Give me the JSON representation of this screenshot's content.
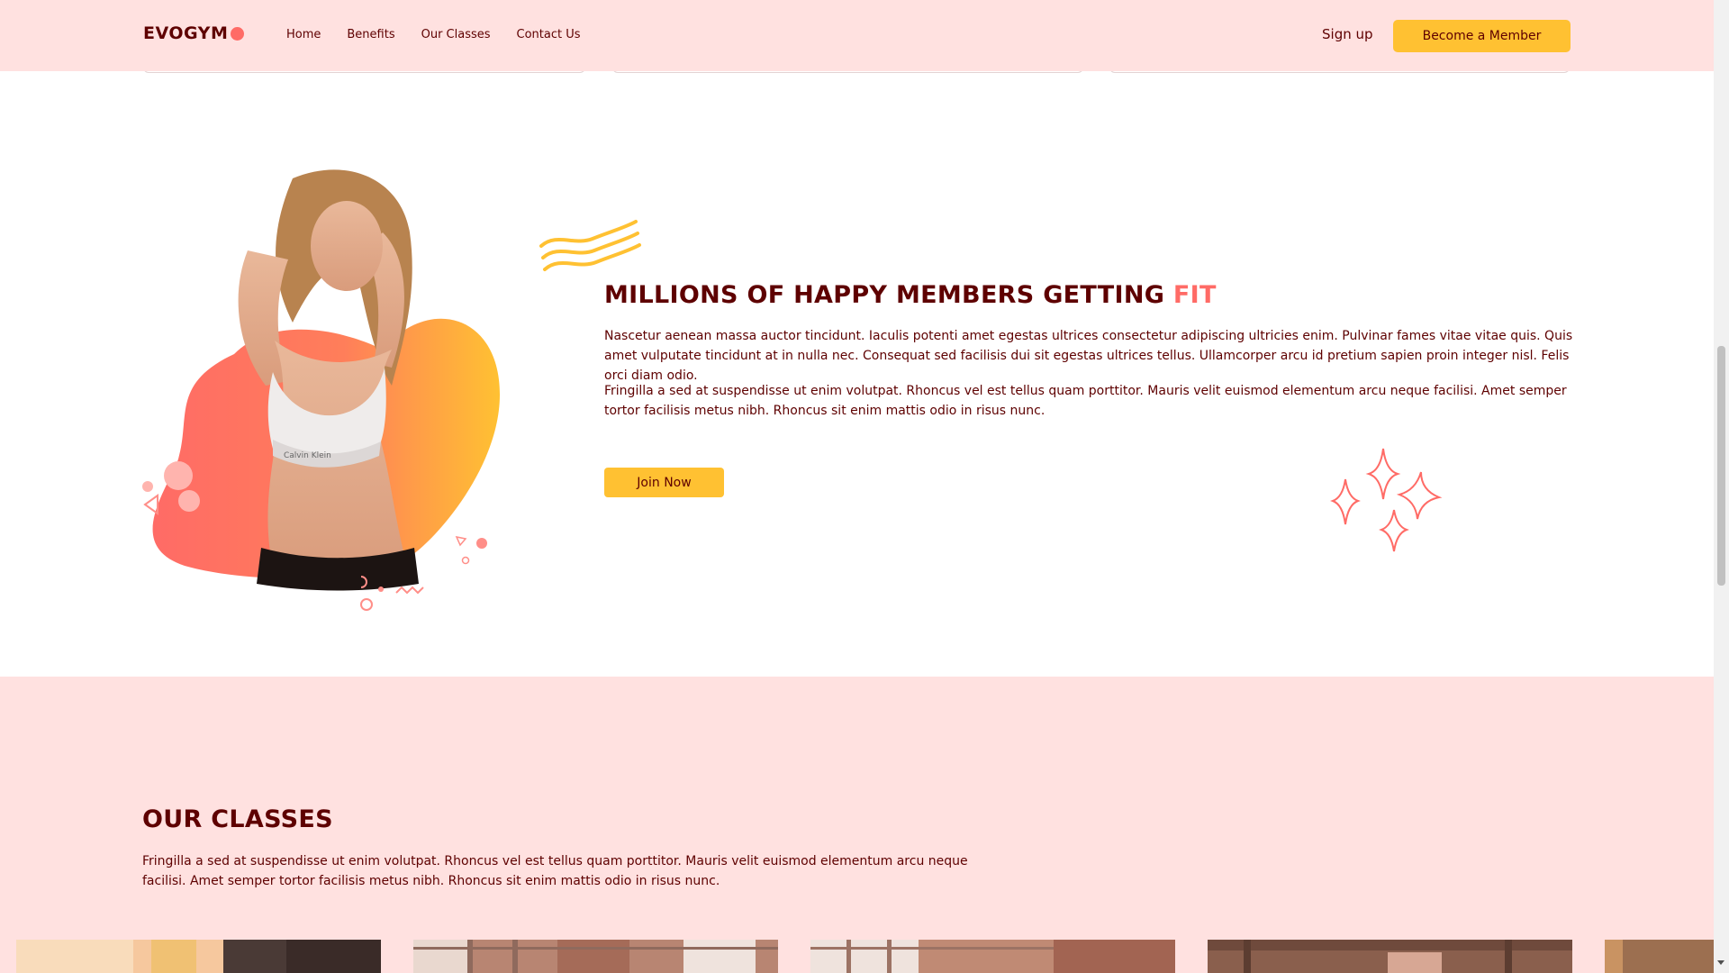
{
  "navbar": {
    "logo_text": "EVOGYM",
    "links": [
      "Home",
      "Benefits",
      "Our Classes",
      "Contact Us"
    ],
    "signup_label": "Sign up",
    "cta_label": "Become a Member"
  },
  "members": {
    "headline": "MILLIONS OF HAPPY MEMBERS GETTING",
    "headline_accent": "FIT",
    "paragraph1": "Nascetur aenean massa auctor tincidunt. Iaculis potenti amet egestas ultrices consectetur adipiscing ultricies enim. Pulvinar fames vitae vitae quis. Quis amet vulputate tincidunt at in nulla nec. Consequat sed facilisis dui sit egestas ultrices tellus. Ullamcorper arcu id pretium sapien proin integer nisl. Felis orci diam odio.",
    "paragraph2": "Fringilla a sed at suspendisse ut enim volutpat. Rhoncus vel est tellus quam porttitor. Mauris velit euismod elementum arcu neque facilisi. Amet semper tortor facilisis metus nibh. Rhoncus sit enim mattis odio in risus nunc.",
    "join_label": "Join Now",
    "graphic_text": "Calvin Klein"
  },
  "classes": {
    "title": "OUR CLASSES",
    "description": "Fringilla a sed at suspendisse ut enim volutpat. Rhoncus vel est tellus quam porttitor. Mauris velit euismod elementum arcu neque facilisi. Amet semper tortor facilisis metus nibh. Rhoncus sit enim mattis odio in risus nunc."
  },
  "colors": {
    "nav_bg": "#ffe1e0",
    "primary_text": "#5e0000",
    "accent_red": "#ff6b66",
    "accent_yellow": "#ffc132"
  },
  "icons": [
    "logo-dot-icon",
    "waves-icon",
    "sparkles-icon"
  ]
}
